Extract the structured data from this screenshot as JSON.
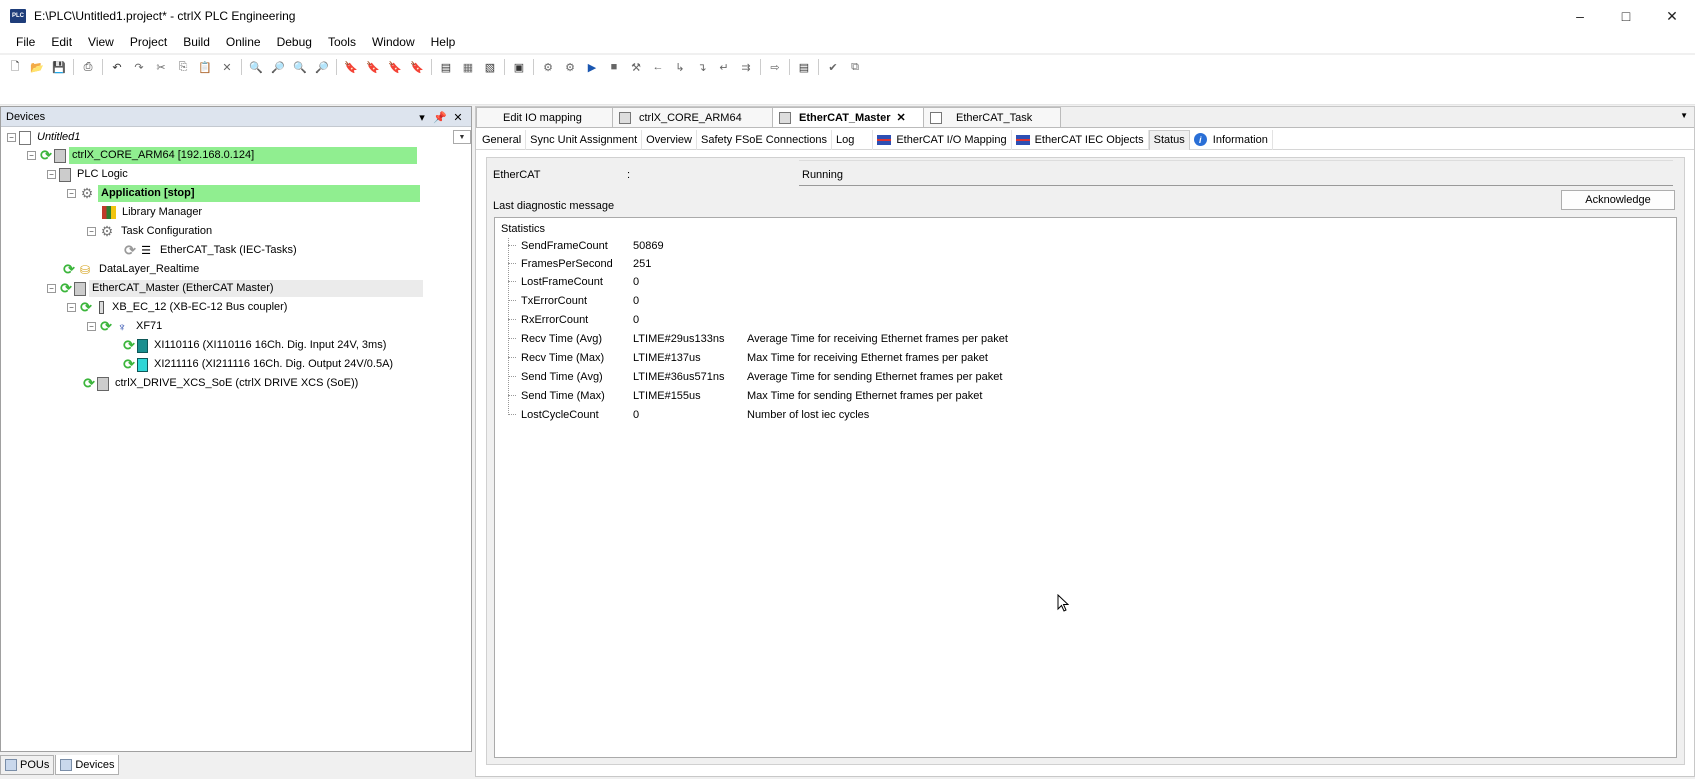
{
  "window": {
    "title": "E:\\PLC\\Untitled1.project* - ctrlX PLC Engineering",
    "app_icon_text": "PLC"
  },
  "menu": [
    "File",
    "Edit",
    "View",
    "Project",
    "Build",
    "Online",
    "Debug",
    "Tools",
    "Window",
    "Help"
  ],
  "devices_panel": {
    "title": "Devices",
    "tree": [
      {
        "label": "Untitled1",
        "icon": "project-icon",
        "style": "italic",
        "highlight": ""
      },
      {
        "label": "ctrlX_CORE_ARM64  [192.168.0.124]",
        "icon": "device-icon",
        "style": "",
        "highlight": "green"
      },
      {
        "label": "PLC Logic",
        "icon": "plc-logic-icon",
        "style": "",
        "highlight": ""
      },
      {
        "label": "Application [stop]",
        "icon": "application-gear-icon",
        "style": "bold",
        "highlight": "green"
      },
      {
        "label": "Library Manager",
        "icon": "library-icon",
        "style": "",
        "highlight": ""
      },
      {
        "label": "Task Configuration",
        "icon": "task-config-icon",
        "style": "",
        "highlight": ""
      },
      {
        "label": "EtherCAT_Task (IEC-Tasks)",
        "icon": "task-icon",
        "style": "",
        "highlight": ""
      },
      {
        "label": "DataLayer_Realtime",
        "icon": "datalayer-icon",
        "style": "",
        "highlight": ""
      },
      {
        "label": "EtherCAT_Master (EtherCAT Master)",
        "icon": "ethercat-master-icon",
        "style": "",
        "highlight": "gray"
      },
      {
        "label": "XB_EC_12 (XB-EC-12 Bus coupler)",
        "icon": "bus-coupler-icon",
        "style": "",
        "highlight": ""
      },
      {
        "label": "XF71",
        "icon": "xf71-icon",
        "style": "",
        "highlight": ""
      },
      {
        "label": "XI110116 (XI110116 16Ch. Dig. Input 24V, 3ms)",
        "icon": "digital-input-icon",
        "style": "",
        "highlight": ""
      },
      {
        "label": "XI211116 (XI211116 16Ch. Dig. Output 24V/0.5A)",
        "icon": "digital-output-icon",
        "style": "",
        "highlight": ""
      },
      {
        "label": "ctrlX_DRIVE_XCS_SoE (ctrlX DRIVE XCS (SoE))",
        "icon": "drive-icon",
        "style": "",
        "highlight": ""
      }
    ]
  },
  "bottom_tabs": [
    "POUs",
    "Devices"
  ],
  "doc_tabs": [
    {
      "label": "Edit IO mapping",
      "active": false
    },
    {
      "label": "ctrlX_CORE_ARM64",
      "active": false
    },
    {
      "label": "EtherCAT_Master",
      "active": true
    },
    {
      "label": "EtherCAT_Task",
      "active": false
    }
  ],
  "sub_tabs": [
    "General",
    "Sync Unit Assignment",
    "Overview",
    "Safety FSoE Connections",
    "Log",
    "EtherCAT I/O Mapping",
    "EtherCAT IEC Objects",
    "Status",
    "Information"
  ],
  "status": {
    "ethercat_label": "EtherCAT",
    "colon": ":",
    "state": "Running",
    "last_diag_label": "Last diagnostic message",
    "acknowledge_label": "Acknowledge",
    "statistics_title": "Statistics",
    "stats": [
      {
        "name": "SendFrameCount",
        "value": "50869",
        "desc": ""
      },
      {
        "name": "FramesPerSecond",
        "value": "251",
        "desc": ""
      },
      {
        "name": "LostFrameCount",
        "value": "0",
        "desc": ""
      },
      {
        "name": "TxErrorCount",
        "value": "0",
        "desc": ""
      },
      {
        "name": "RxErrorCount",
        "value": "0",
        "desc": ""
      },
      {
        "name": "Recv Time (Avg)",
        "value": "LTIME#29us133ns",
        "desc": "Average Time for receiving Ethernet frames per paket"
      },
      {
        "name": "Recv Time (Max)",
        "value": "LTIME#137us",
        "desc": "Max Time for receiving Ethernet frames per paket"
      },
      {
        "name": "Send Time (Avg)",
        "value": "LTIME#36us571ns",
        "desc": "Average Time for sending Ethernet frames per paket"
      },
      {
        "name": "Send Time (Max)",
        "value": "LTIME#155us",
        "desc": "Max Time for sending Ethernet frames per paket"
      },
      {
        "name": "LostCycleCount",
        "value": "0",
        "desc": "Number of lost iec cycles"
      }
    ]
  }
}
